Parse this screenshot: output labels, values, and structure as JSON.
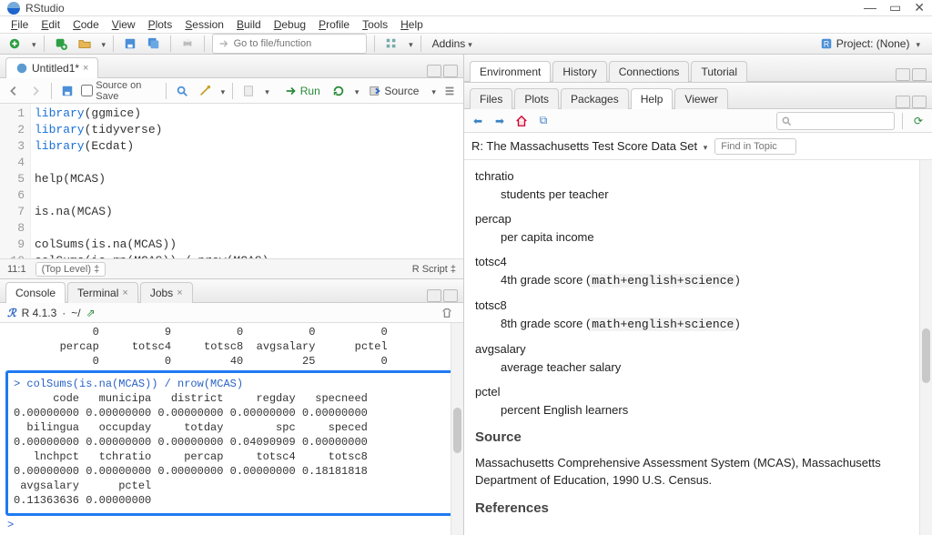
{
  "app": {
    "title": "RStudio"
  },
  "window_buttons": {
    "min": "—",
    "max": "▭",
    "close": "✕"
  },
  "menu": [
    "File",
    "Edit",
    "Code",
    "View",
    "Plots",
    "Session",
    "Build",
    "Debug",
    "Profile",
    "Tools",
    "Help"
  ],
  "toolbar": {
    "goto_placeholder": "Go to file/function",
    "addins_label": "Addins",
    "project_label": "Project: (None)"
  },
  "editor": {
    "tab_title": "Untitled1*",
    "source_on_save": "Source on Save",
    "run_label": "Run",
    "source_label": "Source",
    "lines": [
      "library(ggmice)",
      "library(tidyverse)",
      "library(Ecdat)",
      "",
      "help(MCAS)",
      "",
      "is.na(MCAS)",
      "",
      "colSums(is.na(MCAS))",
      "colSums(is.na(MCAS)) / nrow(MCAS)",
      ""
    ],
    "status_pos": "11:1",
    "scope": "(Top Level)",
    "lang": "R Script"
  },
  "console": {
    "tabs": [
      "Console",
      "Terminal",
      "Jobs"
    ],
    "version": "R 4.1.3",
    "path": "~/",
    "pre_header": "        percap     totsc4     totsc8  avgsalary      pctel",
    "pre_values": "             0          0         40         25          0",
    "top_values": "             0          9          0          0          0",
    "highlight_cmd": "> colSums(is.na(MCAS)) / nrow(MCAS)",
    "rows": [
      "      code   municipa   district     regday   specneed",
      "0.00000000 0.00000000 0.00000000 0.00000000 0.00000000",
      "  bilingua   occupday     totday        spc     speced",
      "0.00000000 0.00000000 0.00000000 0.04090909 0.00000000",
      "   lnchpct   tchratio     percap     totsc4     totsc8",
      "0.00000000 0.00000000 0.00000000 0.00000000 0.18181818",
      " avgsalary      pctel",
      "0.11363636 0.00000000"
    ],
    "prompt": ">"
  },
  "right_top": {
    "tabs": [
      "Environment",
      "History",
      "Connections",
      "Tutorial"
    ]
  },
  "right_mid": {
    "tabs": [
      "Files",
      "Plots",
      "Packages",
      "Help",
      "Viewer"
    ],
    "search_placeholder": "",
    "doc_title": "R: The Massachusetts Test Score Data Set",
    "find_in_topic": "Find in Topic"
  },
  "help": {
    "items": [
      {
        "term": "tchratio",
        "def": "students per teacher"
      },
      {
        "term": "percap",
        "def": "per capita income"
      },
      {
        "term": "totsc4",
        "def": "4th grade score (",
        "code": "math+english+science",
        "def2": ")"
      },
      {
        "term": "totsc8",
        "def": "8th grade score (",
        "code": "math+english+science",
        "def2": ")"
      },
      {
        "term": "avgsalary",
        "def": "average teacher salary"
      },
      {
        "term": "pctel",
        "def": "percent English learners"
      }
    ],
    "source_h": "Source",
    "source_p": "Massachusetts Comprehensive Assessment System (MCAS), Massachusetts Department of Education, 1990 U.S. Census.",
    "refs_h": "References"
  }
}
